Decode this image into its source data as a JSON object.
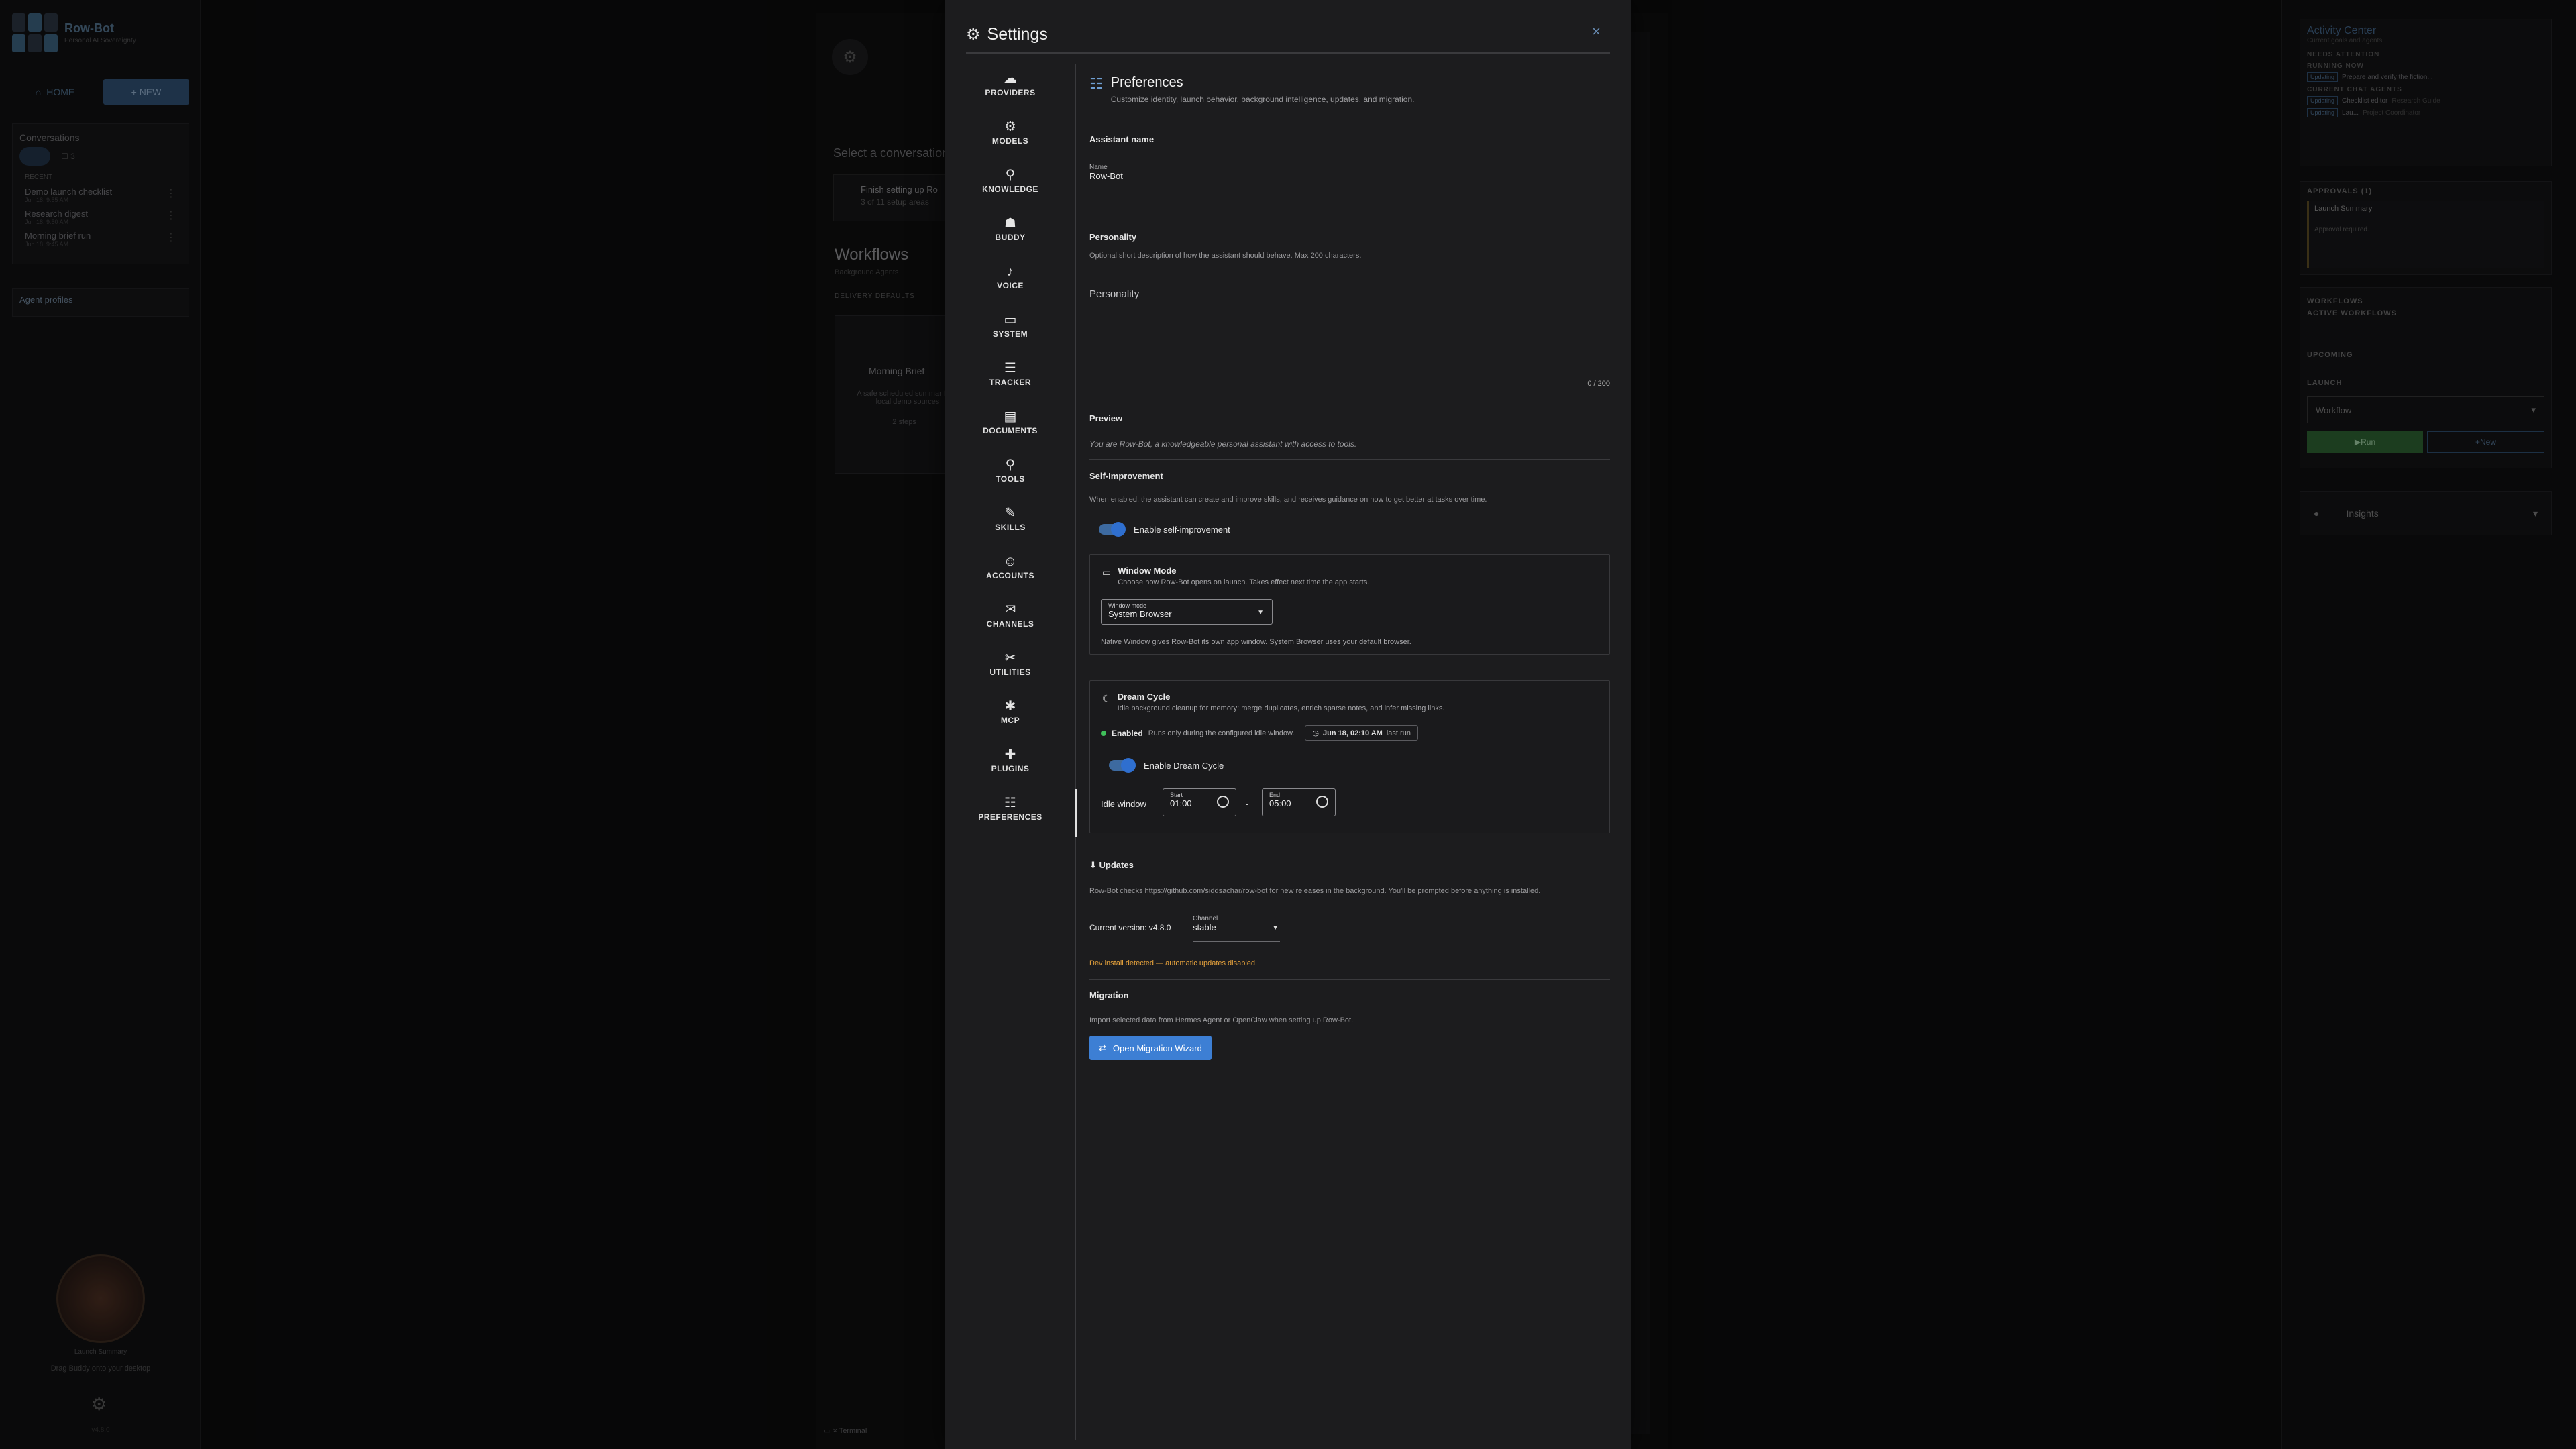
{
  "app": {
    "name": "Row-Bot",
    "tagline": "Personal AI Sovereignty",
    "version": "v4.8.0"
  },
  "left_sidebar": {
    "home_label": "HOME",
    "new_label": "+ NEW",
    "conversations_title": "Conversations",
    "conv_tab_count": "3",
    "recent_label": "RECENT",
    "conversations": [
      {
        "title": "Demo launch checklist",
        "date": "Jun 18, 9:55 AM"
      },
      {
        "title": "Research digest",
        "date": "Jun 18, 9:50 AM"
      },
      {
        "title": "Morning brief run",
        "date": "Jun 18, 9:45 AM"
      }
    ],
    "agent_profiles_label": "Agent profiles",
    "buddy_label": "Launch Summary",
    "buddy_drag_text": "Drag Buddy onto your desktop"
  },
  "background": {
    "select_conversation": "Select a conversation",
    "setup_title": "Finish setting up Ro",
    "setup_sub": "3 of 11 setup areas",
    "workflows_title": "Workflows",
    "workflows_sub": "Background Agents",
    "delivery_defaults": "DELIVERY DEFAULTS",
    "card_name": "Morning Brief",
    "card_desc": "A safe scheduled summar from local demo sources",
    "card_steps": "2 steps",
    "terminal_label": "Terminal"
  },
  "activity": {
    "title": "Activity Center",
    "subtitle": "Current goals and agents",
    "needs_attention": "NEEDS ATTENTION",
    "running_now": "RUNNING NOW",
    "running_task": "Prepare and verify the fiction...",
    "running_tag": "Updating",
    "current_chat_agents": "CURRENT CHAT AGENTS",
    "agents": [
      {
        "tag": "Updating",
        "name": "Checklist editor",
        "role": "Research Guide"
      },
      {
        "tag": "Updating",
        "name": "Lau...",
        "role": "Project Coordinator"
      }
    ],
    "approvals_label": "APPROVALS (1)",
    "approval_title": "Launch Summary",
    "approval_text": "Approval required.",
    "workflows_label": "WORKFLOWS",
    "active_workflows": "ACTIVE WORKFLOWS",
    "upcoming": "UPCOMING",
    "launch": "LAUNCH",
    "workflow_select": "Workflow",
    "run_label": "Run",
    "new_label": "New",
    "insights_label": "Insights"
  },
  "settings": {
    "title": "Settings",
    "nav": [
      {
        "label": "PROVIDERS",
        "icon": "☁"
      },
      {
        "label": "MODELS",
        "icon": "⚙"
      },
      {
        "label": "KNOWLEDGE",
        "icon": "⚲"
      },
      {
        "label": "BUDDY",
        "icon": "☗"
      },
      {
        "label": "VOICE",
        "icon": "♪"
      },
      {
        "label": "SYSTEM",
        "icon": "▭"
      },
      {
        "label": "TRACKER",
        "icon": "☰"
      },
      {
        "label": "DOCUMENTS",
        "icon": "▤"
      },
      {
        "label": "TOOLS",
        "icon": "⚲"
      },
      {
        "label": "SKILLS",
        "icon": "✎"
      },
      {
        "label": "ACCOUNTS",
        "icon": "☺"
      },
      {
        "label": "CHANNELS",
        "icon": "✉"
      },
      {
        "label": "UTILITIES",
        "icon": "✂"
      },
      {
        "label": "MCP",
        "icon": "✱"
      },
      {
        "label": "PLUGINS",
        "icon": "✚"
      },
      {
        "label": "PREFERENCES",
        "icon": "☷"
      }
    ],
    "preferences": {
      "title": "Preferences",
      "subtitle": "Customize identity, launch behavior, background intelligence, updates, and migration.",
      "assistant_name_title": "Assistant name",
      "name_label": "Name",
      "name_value": "Row-Bot",
      "personality_title": "Personality",
      "personality_desc": "Optional short description of how the assistant should behave. Max 200 characters.",
      "personality_placeholder": "Personality",
      "personality_counter": "0 / 200",
      "preview_title": "Preview",
      "preview_text": "You are Row-Bot, a knowledgeable personal assistant with access to tools.",
      "self_improvement_title": "Self-Improvement",
      "self_improvement_desc": "When enabled, the assistant can create and improve skills, and receives guidance on how to get better at tasks over time.",
      "self_improvement_toggle": "Enable self-improvement",
      "window_mode_title": "Window Mode",
      "window_mode_desc": "Choose how Row-Bot opens on launch. Takes effect next time the app starts.",
      "window_mode_label": "Window mode",
      "window_mode_value": "System Browser",
      "window_mode_note": "Native Window gives Row-Bot its own app window. System Browser uses your default browser.",
      "dream_title": "Dream Cycle",
      "dream_desc": "Idle background cleanup for memory: merge duplicates, enrich sparse notes, and infer missing links.",
      "dream_status": "Enabled",
      "dream_status_desc": "Runs only during the configured idle window.",
      "dream_last_run_time": "Jun 18, 02:10 AM",
      "dream_last_run_label": "last run",
      "dream_toggle": "Enable Dream Cycle",
      "idle_window_label": "Idle window",
      "start_label": "Start",
      "start_value": "01:00",
      "end_label": "End",
      "end_value": "05:00",
      "range_sep": "-",
      "updates_title": "Updates",
      "updates_desc": "Row-Bot checks https://github.com/siddsachar/row-bot for new releases in the background. You'll be prompted before anything is installed.",
      "current_version": "Current version: v4.8.0",
      "channel_label": "Channel",
      "channel_value": "stable",
      "dev_warning": "Dev install detected — automatic updates disabled.",
      "migration_title": "Migration",
      "migration_desc": "Import selected data from Hermes Agent or OpenClaw when setting up Row-Bot.",
      "migration_button": "Open Migration Wizard"
    }
  },
  "colors": {
    "accent": "#3d7fd4",
    "warning": "#e6a23c",
    "success": "#3fbf5a"
  }
}
